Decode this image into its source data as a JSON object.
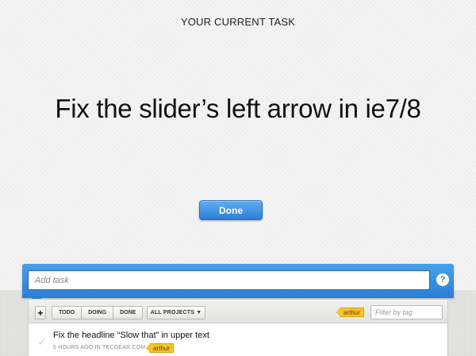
{
  "header": {
    "label": "YOUR CURRENT TASK",
    "current_task": "Fix the slider’s left arrow in ie7/8",
    "done_label": "Done"
  },
  "add_task": {
    "placeholder": "Add task",
    "help_symbol": "?"
  },
  "toolbar": {
    "add_symbol": "+",
    "tabs": [
      {
        "label": "TODO"
      },
      {
        "label": "DOING"
      },
      {
        "label": "DONE"
      }
    ],
    "projects_label": "ALL PROJECTS ▼",
    "active_tag": "arthur",
    "filter_placeholder": "Filter by tag"
  },
  "tasks": [
    {
      "title": "Fix the headline “Slow that” in upper text",
      "meta": "5 HOURS AGO IN TECGEAR.COM",
      "tag": "arthur",
      "check_glyph": "✓"
    }
  ],
  "colors": {
    "accent_blue": "#2a7fd4",
    "tag_yellow": "#f9c12c"
  }
}
